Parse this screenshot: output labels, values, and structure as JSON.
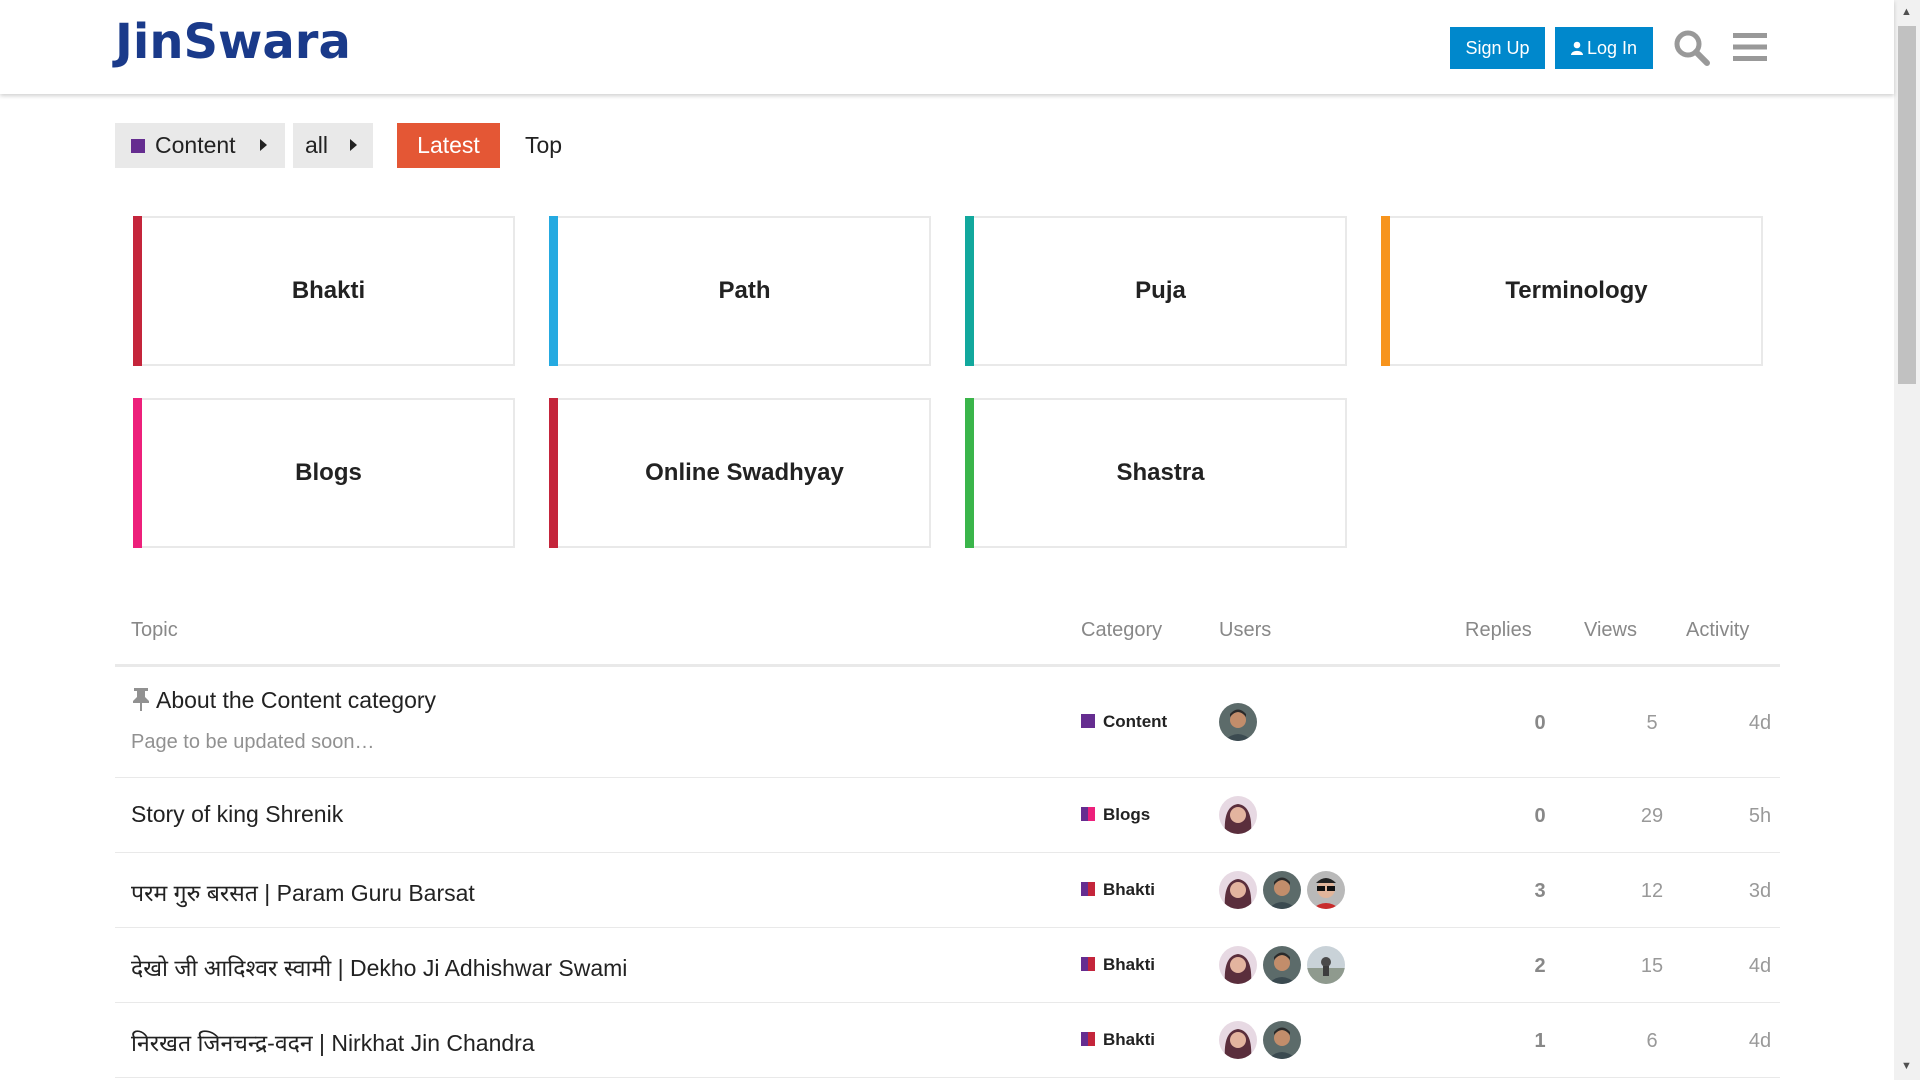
{
  "header": {
    "logo": "JinSwara",
    "signup_label": "Sign Up",
    "login_label": "Log In",
    "login_icon": "user-icon",
    "search_icon": "search-icon",
    "menu_icon": "hamburger-menu-icon",
    "brand_color": "#1a3a8a",
    "button_color": "#0088cc"
  },
  "nav": {
    "category_label": "Content",
    "category_color": "#652d90",
    "subcategory_label": "all",
    "tabs": [
      {
        "label": "Latest",
        "active": true,
        "color": "#e45735"
      },
      {
        "label": "Top",
        "active": false
      }
    ]
  },
  "categories": [
    {
      "name": "Bhakti",
      "color": "#c4253b"
    },
    {
      "name": "Path",
      "color": "#25aae1"
    },
    {
      "name": "Puja",
      "color": "#12a89d"
    },
    {
      "name": "Terminology",
      "color": "#f7941d"
    },
    {
      "name": "Blogs",
      "color": "#ed207b"
    },
    {
      "name": "Online Swadhyay",
      "color": "#c4253b"
    },
    {
      "name": "Shastra",
      "color": "#3ab54a"
    }
  ],
  "table": {
    "headers": {
      "topic": "Topic",
      "category": "Category",
      "users": "Users",
      "replies": "Replies",
      "views": "Views",
      "activity": "Activity"
    },
    "rows": [
      {
        "title": "About the Content category",
        "pinned": true,
        "excerpt": "Page to be updated soon…",
        "category": "Content",
        "category_colors": [
          "#652d90",
          "#652d90"
        ],
        "replies": "0",
        "views": "5",
        "activity": "4d",
        "users": [
          "avatar-man"
        ]
      },
      {
        "title": "Story of king Shrenik",
        "pinned": false,
        "excerpt": "",
        "category": "Blogs",
        "category_colors": [
          "#652d90",
          "#ed207b"
        ],
        "replies": "0",
        "views": "29",
        "activity": "5h",
        "users": [
          "avatar-woman"
        ]
      },
      {
        "title": "परम गुरु बरसत | Param Guru Barsat",
        "pinned": false,
        "excerpt": "",
        "category": "Bhakti",
        "category_colors": [
          "#652d90",
          "#c4253b"
        ],
        "replies": "3",
        "views": "12",
        "activity": "3d",
        "users": [
          "avatar-woman",
          "avatar-man",
          "avatar-sunglasses"
        ]
      },
      {
        "title": "देखो जी आदिश्वर स्वामी | Dekho Ji Adhishwar Swami",
        "pinned": false,
        "excerpt": "",
        "category": "Bhakti",
        "category_colors": [
          "#652d90",
          "#c4253b"
        ],
        "replies": "2",
        "views": "15",
        "activity": "4d",
        "users": [
          "avatar-woman",
          "avatar-man",
          "avatar-landscape"
        ]
      },
      {
        "title": "निरखत जिनचन्द्र-वदन | Nirkhat Jin Chandra",
        "pinned": false,
        "excerpt": "",
        "category": "Bhakti",
        "category_colors": [
          "#652d90",
          "#c4253b"
        ],
        "replies": "1",
        "views": "6",
        "activity": "4d",
        "users": [
          "avatar-woman",
          "avatar-man"
        ]
      }
    ]
  }
}
